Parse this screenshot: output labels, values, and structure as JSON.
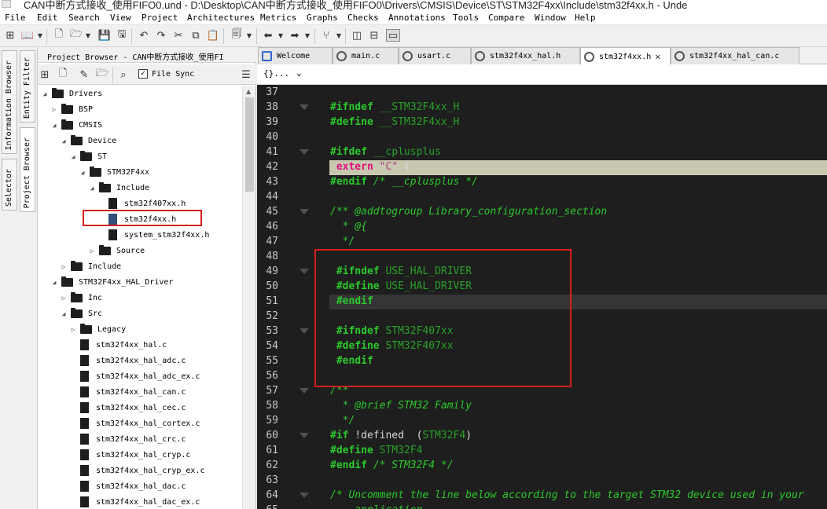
{
  "window": {
    "title": "CAN中断方式接收_使用FIFO0.und - D:\\Desktop\\CAN中断方式接收_使用FIFO0\\Drivers\\CMSIS\\Device\\ST\\STM32F4xx\\Include\\stm32f4xx.h - Unde"
  },
  "menu": [
    "File",
    "Edit",
    "Search",
    "View",
    "Project",
    "Architectures",
    "Metrics",
    "Graphs",
    "Checks",
    "Annotations",
    "Tools",
    "Compare",
    "Window",
    "Help"
  ],
  "side_tabs": [
    "Entity Filter",
    "Information Browser",
    "Project Browser",
    "Selector"
  ],
  "project_browser": {
    "title": "Project Browser - CAN中断方式接收_使用FI",
    "file_sync_label": "File Sync",
    "file_sync_checked": true,
    "tree": [
      {
        "label": "Drivers",
        "type": "folder",
        "depth": 0,
        "expanded": true
      },
      {
        "label": "BSP",
        "type": "folder",
        "depth": 1,
        "expanded": false
      },
      {
        "label": "CMSIS",
        "type": "folder",
        "depth": 1,
        "expanded": true
      },
      {
        "label": "Device",
        "type": "folder",
        "depth": 2,
        "expanded": true
      },
      {
        "label": "ST",
        "type": "folder",
        "depth": 3,
        "expanded": true
      },
      {
        "label": "STM32F4xx",
        "type": "folder",
        "depth": 4,
        "expanded": true
      },
      {
        "label": "Include",
        "type": "folder",
        "depth": 5,
        "expanded": true
      },
      {
        "label": "stm32f407xx.h",
        "type": "file",
        "depth": 6
      },
      {
        "label": "stm32f4xx.h",
        "type": "file",
        "depth": 6,
        "selected": true
      },
      {
        "label": "system_stm32f4xx.h",
        "type": "file",
        "depth": 6
      },
      {
        "label": "Source",
        "type": "folder",
        "depth": 5,
        "expanded": false
      },
      {
        "label": "Include",
        "type": "folder",
        "depth": 2,
        "expanded": false
      },
      {
        "label": "STM32F4xx_HAL_Driver",
        "type": "folder",
        "depth": 1,
        "expanded": true
      },
      {
        "label": "Inc",
        "type": "folder",
        "depth": 2,
        "expanded": false
      },
      {
        "label": "Src",
        "type": "folder",
        "depth": 2,
        "expanded": true
      },
      {
        "label": "Legacy",
        "type": "folder",
        "depth": 3,
        "expanded": false
      },
      {
        "label": "stm32f4xx_hal.c",
        "type": "file",
        "depth": 3
      },
      {
        "label": "stm32f4xx_hal_adc.c",
        "type": "file",
        "depth": 3
      },
      {
        "label": "stm32f4xx_hal_adc_ex.c",
        "type": "file",
        "depth": 3
      },
      {
        "label": "stm32f4xx_hal_can.c",
        "type": "file",
        "depth": 3
      },
      {
        "label": "stm32f4xx_hal_cec.c",
        "type": "file",
        "depth": 3
      },
      {
        "label": "stm32f4xx_hal_cortex.c",
        "type": "file",
        "depth": 3
      },
      {
        "label": "stm32f4xx_hal_crc.c",
        "type": "file",
        "depth": 3
      },
      {
        "label": "stm32f4xx_hal_cryp.c",
        "type": "file",
        "depth": 3
      },
      {
        "label": "stm32f4xx_hal_cryp_ex.c",
        "type": "file",
        "depth": 3
      },
      {
        "label": "stm32f4xx_hal_dac.c",
        "type": "file",
        "depth": 3
      },
      {
        "label": "stm32f4xx_hal_dac_ex.c",
        "type": "file",
        "depth": 3
      }
    ]
  },
  "tabs": [
    {
      "label": "Welcome",
      "active": false
    },
    {
      "label": "main.c",
      "active": false
    },
    {
      "label": "usart.c",
      "active": false
    },
    {
      "label": "stm32f4xx_hal.h",
      "active": false
    },
    {
      "label": "stm32f4xx.h",
      "active": true
    },
    {
      "label": "stm32f4xx_hal_can.c",
      "active": false
    }
  ],
  "breadcrumb": "{}...",
  "code": [
    {
      "n": "37",
      "fold": false,
      "parts": []
    },
    {
      "n": "38",
      "fold": true,
      "parts": [
        [
          "pp",
          "#ifndef "
        ],
        [
          "mac",
          "__STM32F4xx_H"
        ]
      ]
    },
    {
      "n": "39",
      "fold": false,
      "parts": [
        [
          "pp",
          "#define "
        ],
        [
          "mac",
          "__STM32F4xx_H"
        ]
      ]
    },
    {
      "n": "40",
      "fold": false,
      "parts": []
    },
    {
      "n": "41",
      "fold": true,
      "parts": [
        [
          "pp",
          "#ifdef "
        ],
        [
          "mac",
          "__cplusplus"
        ]
      ]
    },
    {
      "n": "42",
      "fold": false,
      "sel": true,
      "parts": [
        [
          "kw",
          " extern "
        ],
        [
          "str",
          "\"C\""
        ],
        [
          "wh",
          " {"
        ]
      ]
    },
    {
      "n": "43",
      "fold": false,
      "parts": [
        [
          "pp",
          "#endif "
        ],
        [
          "cm",
          "/* __cplusplus */"
        ]
      ]
    },
    {
      "n": "44",
      "fold": false,
      "parts": []
    },
    {
      "n": "45",
      "fold": true,
      "parts": [
        [
          "cm",
          "/** @addtogroup Library_configuration_section"
        ]
      ]
    },
    {
      "n": "46",
      "fold": false,
      "parts": [
        [
          "cm",
          "  * @{"
        ]
      ]
    },
    {
      "n": "47",
      "fold": false,
      "parts": [
        [
          "cm",
          "  */"
        ]
      ]
    },
    {
      "n": "48",
      "fold": false,
      "parts": []
    },
    {
      "n": "49",
      "fold": true,
      "parts": [
        [
          "pp",
          " #ifndef "
        ],
        [
          "mac",
          "USE_HAL_DRIVER"
        ]
      ]
    },
    {
      "n": "50",
      "fold": false,
      "parts": [
        [
          "pp",
          " #define "
        ],
        [
          "mac",
          "USE_HAL_DRIVER"
        ]
      ]
    },
    {
      "n": "51",
      "fold": false,
      "cur": true,
      "parts": [
        [
          "pp",
          " #endif"
        ]
      ]
    },
    {
      "n": "52",
      "fold": false,
      "parts": []
    },
    {
      "n": "53",
      "fold": true,
      "parts": [
        [
          "pp",
          " #ifndef "
        ],
        [
          "mac",
          "STM32F407xx"
        ]
      ]
    },
    {
      "n": "54",
      "fold": false,
      "parts": [
        [
          "pp",
          " #define "
        ],
        [
          "mac",
          "STM32F407xx"
        ]
      ]
    },
    {
      "n": "55",
      "fold": false,
      "parts": [
        [
          "pp",
          " #endif"
        ]
      ]
    },
    {
      "n": "56",
      "fold": false,
      "parts": []
    },
    {
      "n": "57",
      "fold": true,
      "parts": [
        [
          "cm",
          "/**"
        ]
      ]
    },
    {
      "n": "58",
      "fold": false,
      "parts": [
        [
          "cm",
          "  * @brief STM32 Family"
        ]
      ]
    },
    {
      "n": "59",
      "fold": false,
      "parts": [
        [
          "cm",
          "  */"
        ]
      ]
    },
    {
      "n": "60",
      "fold": true,
      "parts": [
        [
          "pp",
          "#if "
        ],
        [
          "wh",
          "!defined  ("
        ],
        [
          "mac",
          "STM32F4"
        ],
        [
          "wh",
          ")"
        ]
      ]
    },
    {
      "n": "61",
      "fold": false,
      "parts": [
        [
          "pp",
          "#define "
        ],
        [
          "mac",
          "STM32F4"
        ]
      ]
    },
    {
      "n": "62",
      "fold": false,
      "parts": [
        [
          "pp",
          "#endif "
        ],
        [
          "cm",
          "/* STM32F4 */"
        ]
      ]
    },
    {
      "n": "63",
      "fold": false,
      "parts": []
    },
    {
      "n": "64",
      "fold": true,
      "parts": [
        [
          "cm",
          "/* Uncomment the line below according to the target STM32 device used in your"
        ]
      ]
    },
    {
      "n": "65",
      "fold": false,
      "parts": [
        [
          "cm",
          "    application"
        ]
      ]
    }
  ]
}
